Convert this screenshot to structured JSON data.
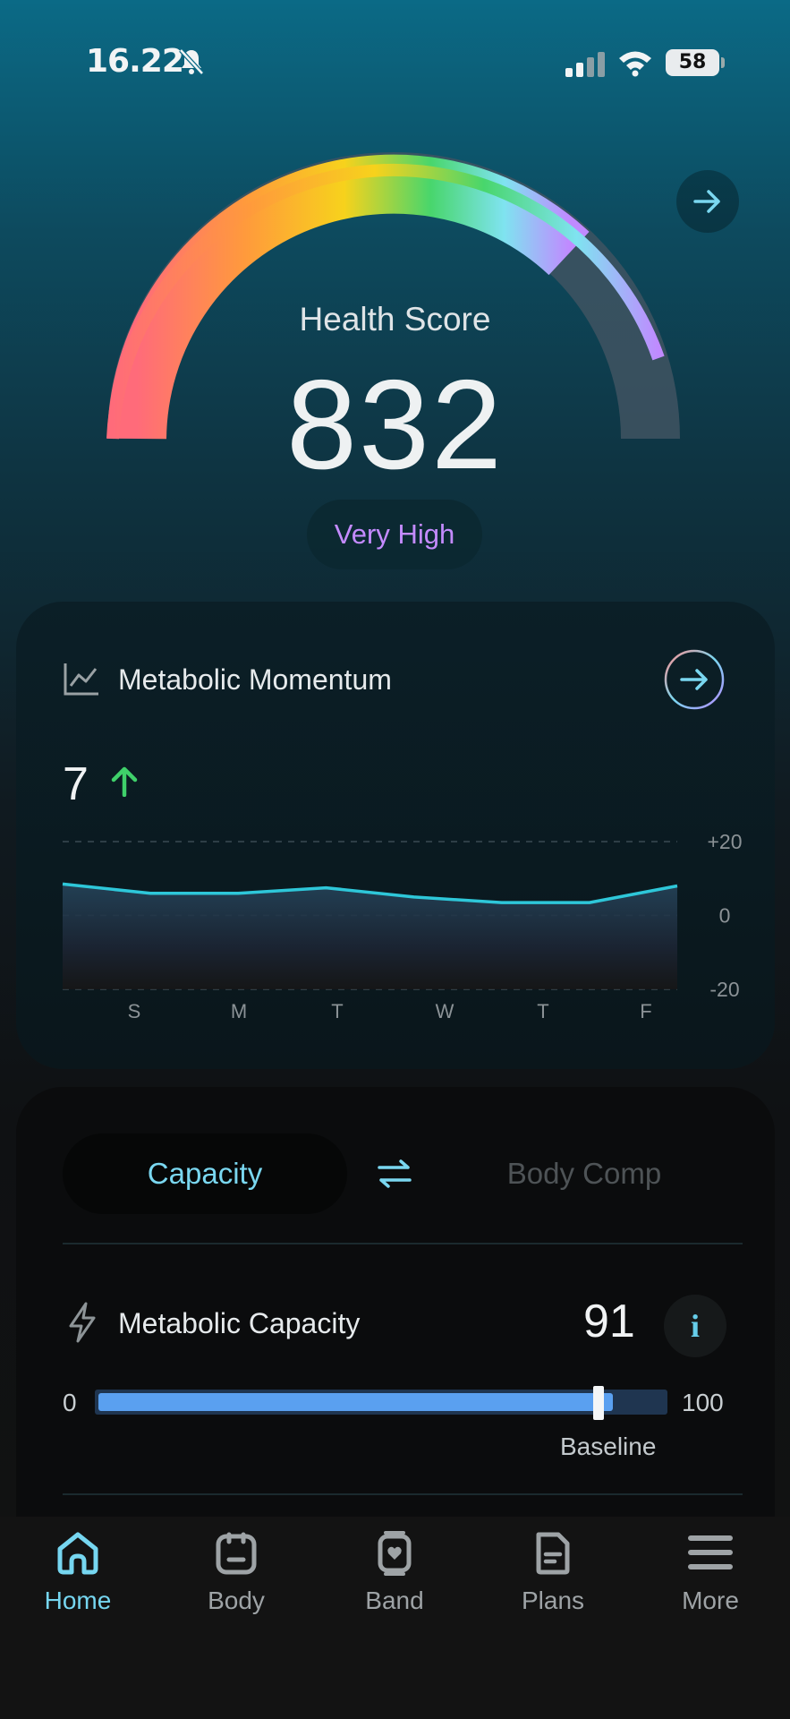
{
  "status_bar": {
    "time": "16.22",
    "battery": "58"
  },
  "health": {
    "label": "Health Score",
    "score": "832",
    "level": "Very High"
  },
  "momentum": {
    "title": "Metabolic Momentum",
    "value": "7",
    "chart_data": {
      "type": "area",
      "x": [
        "S",
        "M",
        "T",
        "W",
        "T",
        "F"
      ],
      "series": [
        {
          "values": [
            8.5,
            6,
            6,
            7.5,
            5,
            3.5,
            3.5,
            8
          ]
        }
      ],
      "yticks": [
        "+20",
        "0",
        "-20"
      ],
      "ylim": [
        -20,
        20
      ],
      "grid": true,
      "colors": {
        "line": "#2ec7d9"
      }
    }
  },
  "toggle": {
    "left": "Capacity",
    "right": "Body Comp"
  },
  "capacity": {
    "title": "Metabolic Capacity",
    "value": "91",
    "info": "i",
    "min": "0",
    "max": "100",
    "fill_percent": 91,
    "baseline_percent": 88,
    "baseline_label": "Baseline"
  },
  "nav": [
    {
      "label": "Home",
      "icon": "home-icon",
      "active": true
    },
    {
      "label": "Body",
      "icon": "body-icon",
      "active": false
    },
    {
      "label": "Band",
      "icon": "band-icon",
      "active": false
    },
    {
      "label": "Plans",
      "icon": "plans-icon",
      "active": false
    },
    {
      "label": "More",
      "icon": "menu-icon",
      "active": false
    }
  ],
  "colors": {
    "accent": "#76d6f0",
    "level": "#c48bff",
    "bar": "#5aa0f0",
    "up": "#3fd06a"
  }
}
